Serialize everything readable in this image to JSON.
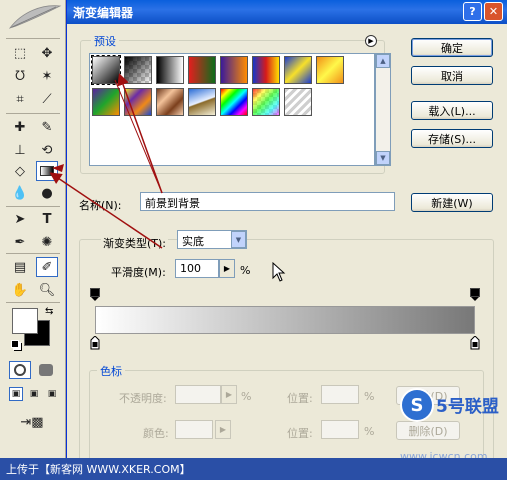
{
  "dialog": {
    "title": "渐变编辑器",
    "help_icon": "?",
    "close_icon": "✕"
  },
  "presets": {
    "legend": "预设",
    "menu_icon": "play-circle-icon",
    "swatches": [
      {
        "name": "foreground-to-background",
        "gradient": "linear-gradient(135deg,#fff,#000)"
      },
      {
        "name": "foreground-to-transparent",
        "gradient": "linear-gradient(135deg,#000,rgba(0,0,0,0))"
      },
      {
        "name": "black-white",
        "gradient": "linear-gradient(90deg,#000,#fff)"
      },
      {
        "name": "red-green",
        "gradient": "linear-gradient(90deg,#e41e1e,#0d6d1b)"
      },
      {
        "name": "violet-orange",
        "gradient": "linear-gradient(90deg,#3a1a9a,#ff8c00)"
      },
      {
        "name": "blue-red-yellow",
        "gradient": "linear-gradient(90deg,#1638c9,#d71a1a,#ffe000)"
      },
      {
        "name": "blue-yellow-blue",
        "gradient": "linear-gradient(135deg,#1a3cd0,#f7e02a,#1a3cd0)"
      },
      {
        "name": "orange-yellow-orange",
        "gradient": "linear-gradient(135deg,#f19018,#fff84a,#f19018)"
      },
      {
        "name": "violet-green-orange",
        "gradient": "linear-gradient(135deg,#5b21a0,#1fa52c,#ff8c00)"
      },
      {
        "name": "yellow-violet-orange-blue",
        "gradient": "linear-gradient(135deg,#f5ea2a,#6c2ba6,#f08a18,#1b49d3)"
      },
      {
        "name": "copper",
        "gradient": "linear-gradient(135deg,#6e3a1e,#f3c29a,#7b3f1c,#f5d0b0)"
      },
      {
        "name": "chrome",
        "gradient": "linear-gradient(160deg,#2a6cd6,#e8f0ff 48%,#8a6a2a 52%,#f4f0d8)"
      },
      {
        "name": "spectrum",
        "gradient": "linear-gradient(135deg,#f00,#ff0,#0f0,#0ff,#00f,#f0f,#f00)"
      },
      {
        "name": "transparent-rainbow",
        "gradient": "linear-gradient(135deg,rgba(255,0,0,0.8),rgba(255,255,0,0.6),rgba(0,255,0,0.6),rgba(0,255,255,0.6),rgba(255,0,255,0.6))"
      },
      {
        "name": "transparent-stripes",
        "gradient": "repeating-linear-gradient(135deg,#cfcfcf 0 3px,#ffffff 3px 6px)"
      }
    ]
  },
  "buttons": {
    "ok": "确定",
    "cancel": "取消",
    "load": "载入(L)...",
    "save": "存储(S)...",
    "new": "新建(W)",
    "delete_opacity": "删除(D)",
    "delete_color": "删除(D)"
  },
  "name_field": {
    "label": "名称(N):",
    "value": "前景到背景"
  },
  "gradient_type": {
    "label": "渐变类型(T):",
    "value": "实底"
  },
  "smoothness": {
    "label": "平滑度(M):",
    "value": "100",
    "unit": "%"
  },
  "color_stops": {
    "legend": "色标",
    "opacity_label": "不透明度:",
    "opacity_unit": "%",
    "location_label_1": "位置:",
    "location_unit_1": "%",
    "color_label": "颜色:",
    "location_label_2": "位置:",
    "location_unit_2": "%"
  },
  "caption": {
    "text": "上传于【新客网 WWW.XKER.COM】"
  },
  "watermark": {
    "text": "5号联盟",
    "url": "www.jcwcn.com"
  },
  "colors": {
    "title_bar": "#0a5fdc",
    "annotation_arrow": "#a01010",
    "foreground": "#ffffff",
    "background": "#000000"
  }
}
